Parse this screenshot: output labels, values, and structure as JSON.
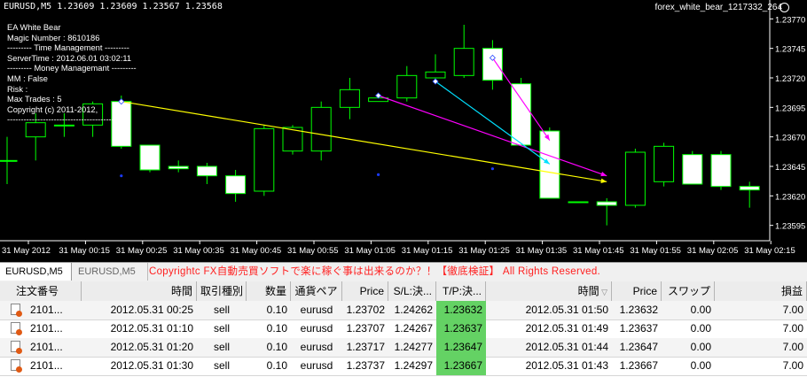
{
  "chart": {
    "symbol_info": "EURUSD,M5  1.23609 1.23609 1.23567 1.23568",
    "ea_name": "forex_white_bear_1217332_264",
    "info_lines": [
      "EA White Bear",
      "Magic Number : 8610186",
      "--------- Time Management ---------",
      "ServerTime : 2012.06.01 03:02:11",
      "--------- Money Managemant ---------",
      "MM : False",
      "Risk :",
      "Max Trades : 5",
      "Copyright (c) 2011-2012, ",
      "------------------------------------------"
    ],
    "price_labels": [
      "1.23770",
      "1.23745",
      "1.23720",
      "1.23695",
      "1.23670",
      "1.23645",
      "1.23620",
      "1.23595"
    ],
    "time_labels": [
      "31 May 2012",
      "31 May 00:15",
      "31 May 00:25",
      "31 May 00:35",
      "31 May 00:45",
      "31 May 00:55",
      "31 May 01:05",
      "31 May 01:15",
      "31 May 01:25",
      "31 May 01:35",
      "31 May 01:45",
      "31 May 01:55",
      "31 May 02:05",
      "31 May 02:15"
    ],
    "colors": {
      "background": "#000000",
      "candle_border": "#00ff00",
      "bull_body": "#000000",
      "bear_body": "#ffffff",
      "line_yellow": "#ffff00",
      "line_magenta": "#ff00ff",
      "line_cyan": "#00e0ff",
      "dot": "#1a3aff"
    }
  },
  "chart_data": {
    "type": "candlestick",
    "ylim": [
      1.23585,
      1.2378
    ],
    "candles": [
      {
        "o": 1.2365,
        "h": 1.2367,
        "l": 1.2363,
        "c": 1.2365
      },
      {
        "o": 1.2367,
        "h": 1.2369,
        "l": 1.2365,
        "c": 1.23682
      },
      {
        "o": 1.2368,
        "h": 1.2369,
        "l": 1.2367,
        "c": 1.2368
      },
      {
        "o": 1.2368,
        "h": 1.237,
        "l": 1.2367,
        "c": 1.23698
      },
      {
        "o": 1.237,
        "h": 1.23705,
        "l": 1.2366,
        "c": 1.23662
      },
      {
        "o": 1.23663,
        "h": 1.23663,
        "l": 1.2364,
        "c": 1.23642
      },
      {
        "o": 1.23645,
        "h": 1.2365,
        "l": 1.2364,
        "c": 1.23643
      },
      {
        "o": 1.23645,
        "h": 1.23648,
        "l": 1.2363,
        "c": 1.23637
      },
      {
        "o": 1.23637,
        "h": 1.23642,
        "l": 1.23615,
        "c": 1.23622
      },
      {
        "o": 1.23624,
        "h": 1.2368,
        "l": 1.2362,
        "c": 1.23677
      },
      {
        "o": 1.23658,
        "h": 1.2368,
        "l": 1.23655,
        "c": 1.23678
      },
      {
        "o": 1.23658,
        "h": 1.237,
        "l": 1.2365,
        "c": 1.23695
      },
      {
        "o": 1.23695,
        "h": 1.2372,
        "l": 1.23685,
        "c": 1.2371
      },
      {
        "o": 1.237,
        "h": 1.23705,
        "l": 1.237,
        "c": 1.23703
      },
      {
        "o": 1.23703,
        "h": 1.2373,
        "l": 1.237,
        "c": 1.23722
      },
      {
        "o": 1.2372,
        "h": 1.2374,
        "l": 1.23715,
        "c": 1.23725
      },
      {
        "o": 1.23722,
        "h": 1.23765,
        "l": 1.2372,
        "c": 1.23745
      },
      {
        "o": 1.23745,
        "h": 1.23752,
        "l": 1.2371,
        "c": 1.23718
      },
      {
        "o": 1.23715,
        "h": 1.2372,
        "l": 1.23663,
        "c": 1.23663
      },
      {
        "o": 1.23675,
        "h": 1.23678,
        "l": 1.23618,
        "c": 1.23618
      },
      {
        "o": 1.23615,
        "h": 1.23615,
        "l": 1.23615,
        "c": 1.23615
      },
      {
        "o": 1.23615,
        "h": 1.23618,
        "l": 1.23595,
        "c": 1.23612
      },
      {
        "o": 1.23612,
        "h": 1.2366,
        "l": 1.2361,
        "c": 1.23657
      },
      {
        "o": 1.23632,
        "h": 1.23665,
        "l": 1.23628,
        "c": 1.23662
      },
      {
        "o": 1.23655,
        "h": 1.23658,
        "l": 1.2363,
        "c": 1.2363
      },
      {
        "o": 1.23655,
        "h": 1.23658,
        "l": 1.23625,
        "c": 1.23628
      },
      {
        "o": 1.23628,
        "h": 1.23632,
        "l": 1.2361,
        "c": 1.23625
      }
    ],
    "trade_lines": [
      {
        "color": "yellow",
        "from": {
          "bar": 4,
          "price": 1.237
        },
        "to": {
          "bar": 21,
          "price": 1.23632
        }
      },
      {
        "color": "magenta",
        "from": {
          "bar": 13,
          "price": 1.23705
        },
        "to": {
          "bar": 21,
          "price": 1.23637
        }
      },
      {
        "color": "cyan",
        "from": {
          "bar": 15,
          "price": 1.23717
        },
        "to": {
          "bar": 19,
          "price": 1.23647
        }
      },
      {
        "color": "magenta",
        "from": {
          "bar": 17,
          "price": 1.23737
        },
        "to": {
          "bar": 19,
          "price": 1.23667
        }
      }
    ],
    "dots": [
      {
        "bar": 4,
        "price": 1.23637
      },
      {
        "bar": 13,
        "price": 1.23638
      },
      {
        "bar": 17,
        "price": 1.23643
      }
    ]
  },
  "tabs": [
    "EURUSD,M5",
    "EURUSD,M5"
  ],
  "copyright": "Copyrightc FX自動売買ソフトで楽に稼ぐ事は出来るのか？！【徹底検証】 All Rights Reserved.",
  "table": {
    "headers": [
      "注文番号",
      "時間",
      "取引種別",
      "数量",
      "通貨ペア",
      "Price",
      "S/L:決...",
      "T/P:決...",
      "時間",
      "Price",
      "スワップ",
      "損益"
    ],
    "rows": [
      [
        "2101...",
        "2012.05.31 00:25",
        "sell",
        "0.10",
        "eurusd",
        "1.23702",
        "1.24262",
        "1.23632",
        "2012.05.31 01:50",
        "1.23632",
        "0.00",
        "7.00"
      ],
      [
        "2101...",
        "2012.05.31 01:10",
        "sell",
        "0.10",
        "eurusd",
        "1.23707",
        "1.24267",
        "1.23637",
        "2012.05.31 01:49",
        "1.23637",
        "0.00",
        "7.00"
      ],
      [
        "2101...",
        "2012.05.31 01:20",
        "sell",
        "0.10",
        "eurusd",
        "1.23717",
        "1.24277",
        "1.23647",
        "2012.05.31 01:44",
        "1.23647",
        "0.00",
        "7.00"
      ],
      [
        "2101...",
        "2012.05.31 01:30",
        "sell",
        "0.10",
        "eurusd",
        "1.23737",
        "1.24297",
        "1.23667",
        "2012.05.31 01:43",
        "1.23667",
        "0.00",
        "7.00"
      ]
    ]
  }
}
